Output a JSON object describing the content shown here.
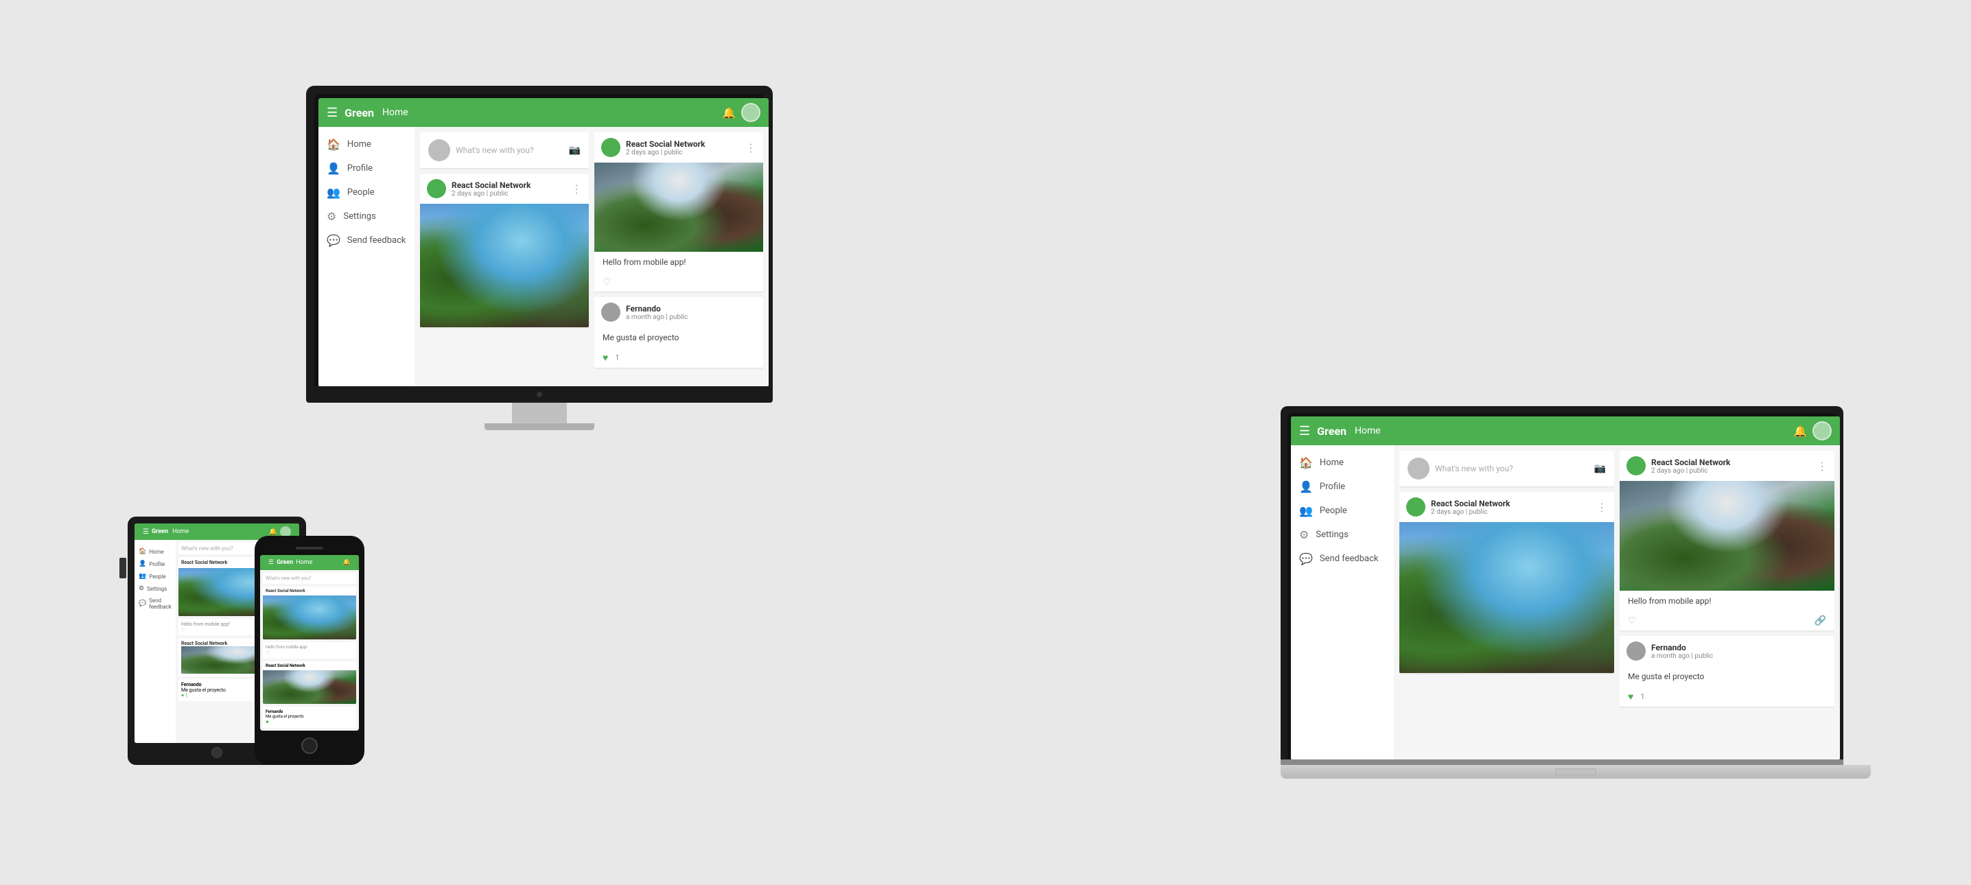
{
  "bg_color": "#e8e8e8",
  "accent_color": "#4caf50",
  "app": {
    "brand": "Green",
    "home_label": "Home",
    "toolbar_title": "Green",
    "toolbar_home": "Home"
  },
  "sidebar": {
    "items": [
      {
        "label": "Home",
        "icon": "🏠"
      },
      {
        "label": "Profile",
        "icon": "👤"
      },
      {
        "label": "People",
        "icon": "👥"
      },
      {
        "label": "Settings",
        "icon": "⚙"
      },
      {
        "label": "Send feedback",
        "icon": "💬"
      }
    ]
  },
  "compose": {
    "placeholder": "What's new with you?"
  },
  "posts": [
    {
      "author": "React Social Network",
      "time": "2 days ago | public",
      "text": ""
    },
    {
      "author": "React Social Network",
      "time": "2 days ago | public",
      "text": "Hello from mobile app!",
      "likes": ""
    },
    {
      "author": "Fernando",
      "time": "a month ago | public",
      "text": "Me gusta el proyecto",
      "likes": "1"
    }
  ]
}
